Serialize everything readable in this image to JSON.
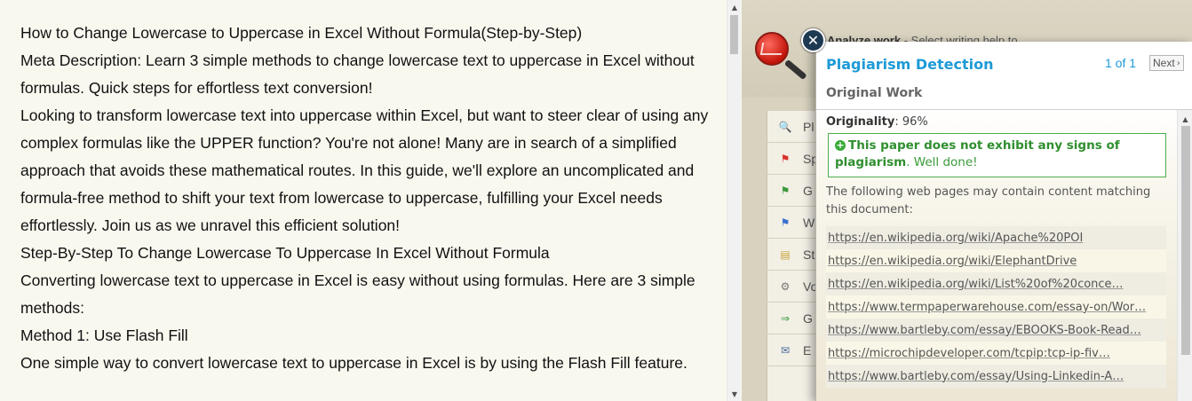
{
  "document": {
    "paragraphs": [
      "How to Change Lowercase to Uppercase in Excel Without Formula(Step-by-Step)",
      "Meta Description: Learn 3 simple methods to change lowercase text to uppercase in Excel without formulas. Quick steps for effortless text conversion!",
      "Looking to transform lowercase text into uppercase within Excel, but want to steer clear of using any complex formulas like the UPPER function? You're not alone! Many are in search of a simplified approach that avoids these mathematical routes. In this guide, we'll explore an uncomplicated and formula-free method to shift your text from lowercase to uppercase, fulfilling your Excel needs effortlessly. Join us as we unravel this efficient solution!",
      "Step-By-Step To Change Lowercase To Uppercase In Excel Without Formula",
      "Converting lowercase text to uppercase in Excel is easy without using formulas. Here are 3 simple methods:",
      "Method 1: Use Flash Fill",
      "One simple way to convert lowercase text to uppercase in Excel is by using the Flash Fill feature."
    ]
  },
  "app": {
    "title_bold": "Analyze work",
    "title_rest": " - Select writing help to"
  },
  "menu": {
    "items": [
      {
        "icon": "magnifier-icon",
        "glyph": "🔍",
        "label": "Pl"
      },
      {
        "icon": "red-flag-icon",
        "glyph": "⚑",
        "label": "Sp",
        "color": "#d9302b"
      },
      {
        "icon": "green-flag-icon",
        "glyph": "⚑",
        "label": "G",
        "color": "#3b9a3b"
      },
      {
        "icon": "blue-flag-icon",
        "glyph": "⚑",
        "label": "W",
        "color": "#3a6fd0"
      },
      {
        "icon": "document-icon",
        "glyph": "▤",
        "label": "St",
        "color": "#c9a43a"
      },
      {
        "icon": "gear-icon",
        "glyph": "⚙",
        "label": "Vo",
        "color": "#777777"
      },
      {
        "icon": "arrow-right-icon",
        "glyph": "⇒",
        "label": "G",
        "color": "#3b9a3b"
      },
      {
        "icon": "envelope-icon",
        "glyph": "✉",
        "label": "E",
        "color": "#4a6a9a"
      }
    ]
  },
  "popup": {
    "close_glyph": "✕",
    "title": "Plagiarism Detection",
    "count": "1 of 1",
    "next_label": "Next",
    "next_glyph": "›",
    "section": "Original Work",
    "originality_label": "Originality",
    "originality_value": ": 96%",
    "verdict_plus": "+",
    "verdict_bold": "This paper does not exhibit any signs of plagiarism",
    "verdict_rest": ". Well done!",
    "following": "The following web pages may contain content matching this document:",
    "links": [
      "https://en.wikipedia.org/wiki/Apache%20POI",
      "https://en.wikipedia.org/wiki/ElephantDrive",
      "https://en.wikipedia.org/wiki/List%20of%20conce…",
      "https://www.termpaperwarehouse.com/essay-on/Wor…",
      "https://www.bartleby.com/essay/EBOOKS-Book-Read…",
      "https://microchipdeveloper.com/tcpip:tcp-ip-fiv…",
      "https://www.bartleby.com/essay/Using-Linkedin-A…"
    ]
  },
  "scrollbar": {
    "up": "▲",
    "down": "▼"
  },
  "colors": {
    "accent": "#1d9ad6",
    "success": "#3a9a3a",
    "close": "#1e3a52"
  }
}
